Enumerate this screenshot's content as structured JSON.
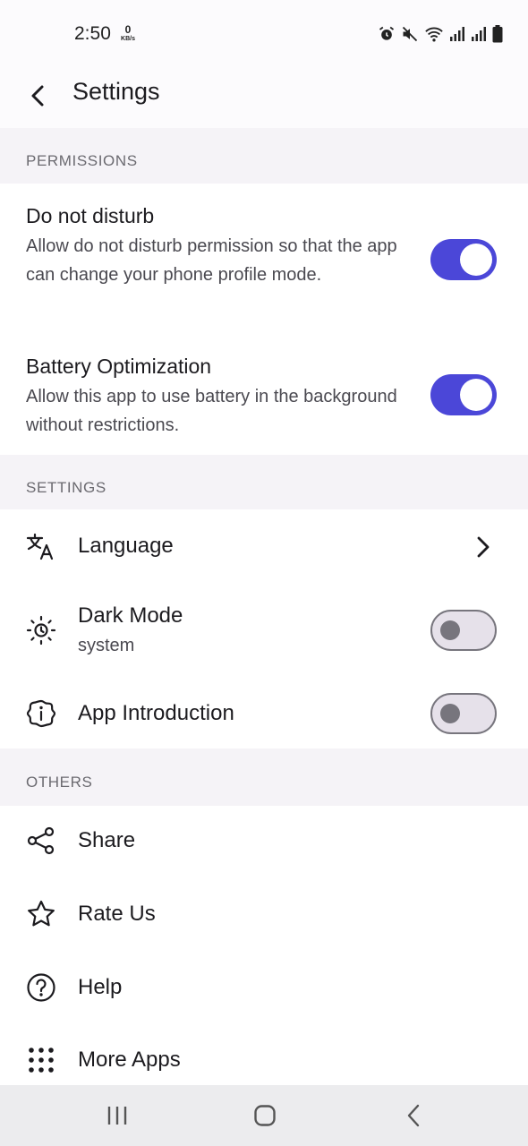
{
  "status_bar": {
    "time": "2:50",
    "net_speed_value": "0",
    "net_speed_unit": "KB/s",
    "icons": [
      "alarm-icon",
      "mute-icon",
      "wifi-icon",
      "signal-icon",
      "signal-icon",
      "battery-icon"
    ]
  },
  "app_bar": {
    "title": "Settings"
  },
  "sections": {
    "permissions": {
      "header": "PERMISSIONS"
    },
    "settings": {
      "header": "SETTINGS"
    },
    "others": {
      "header": "OTHERS"
    }
  },
  "permissions": {
    "dnd": {
      "title": "Do not disturb",
      "description": "Allow do not disturb permission so that the app can change your phone profile mode.",
      "enabled": true
    },
    "battery": {
      "title": "Battery Optimization",
      "description": "Allow this app to use battery in the background without restrictions.",
      "enabled": true
    }
  },
  "settings": {
    "language": {
      "label": "Language",
      "icon": "translate-icon"
    },
    "dark_mode": {
      "label": "Dark Mode",
      "value": "system",
      "icon": "brightness-auto-icon",
      "enabled": false
    },
    "app_intro": {
      "label": "App Introduction",
      "icon": "info-icon",
      "enabled": false
    }
  },
  "others": {
    "share": {
      "label": "Share",
      "icon": "share-icon"
    },
    "rate": {
      "label": "Rate Us",
      "icon": "star-icon"
    },
    "help": {
      "label": "Help",
      "icon": "help-circle-icon"
    },
    "more_apps": {
      "label": "More Apps",
      "icon": "apps-grid-icon"
    }
  },
  "colors": {
    "accent": "#4b47d8",
    "background": "#f5f3f7",
    "card": "#ffffff",
    "section_header_text": "#6b6a70"
  }
}
